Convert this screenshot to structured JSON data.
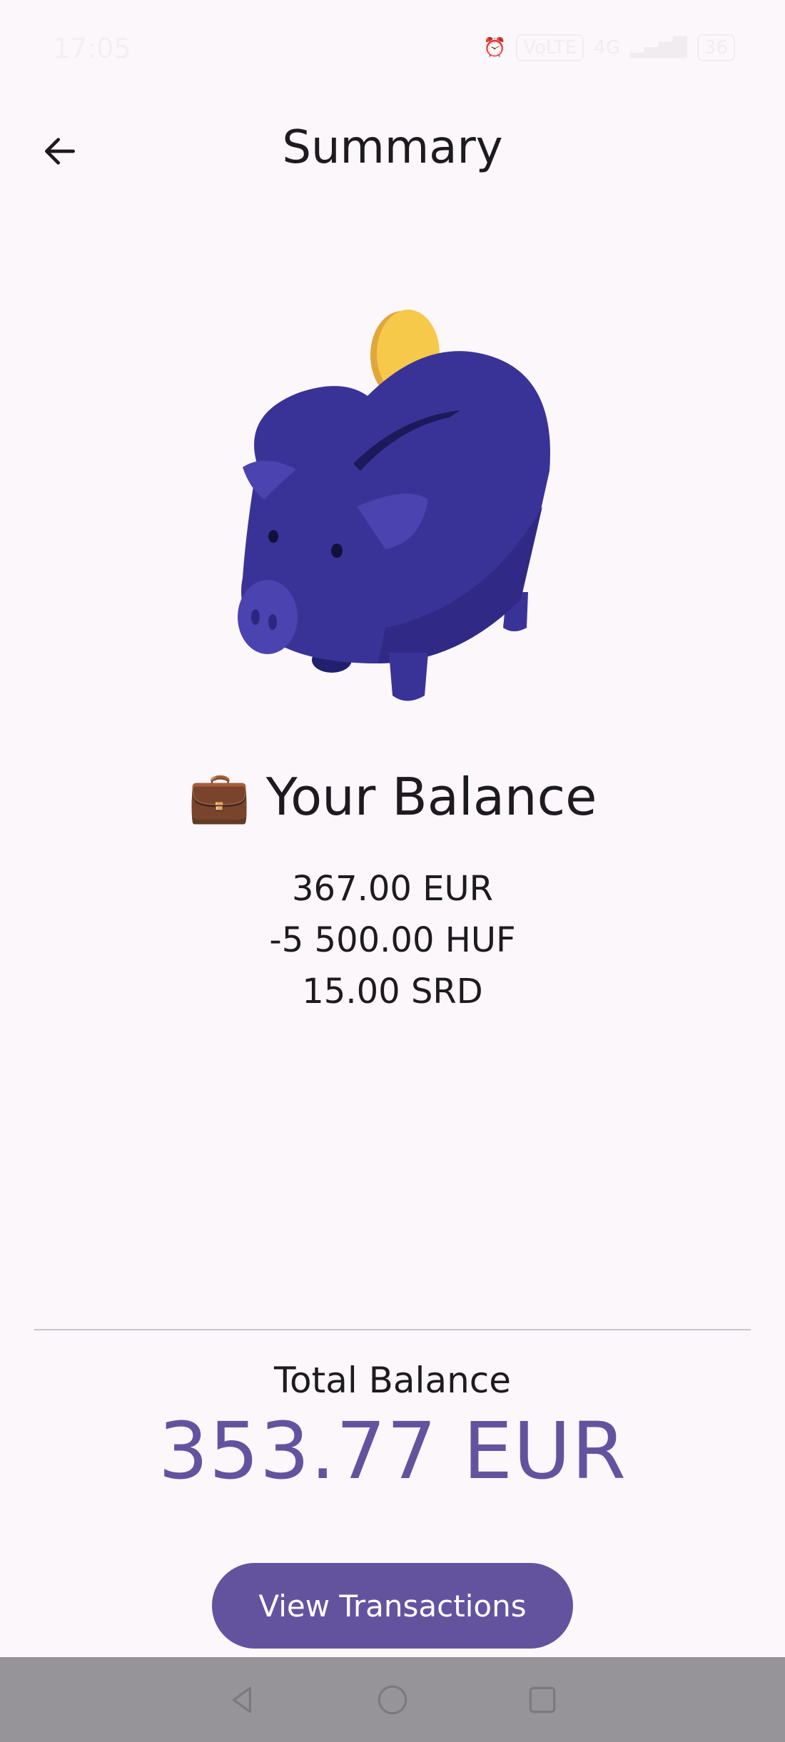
{
  "status_bar": {
    "time": "17:05",
    "network": "4G",
    "data_badge": "VoLTE",
    "battery": "36"
  },
  "app_bar": {
    "title": "Summary",
    "back_icon": "arrow-left-icon"
  },
  "illustration": {
    "name": "piggy-bank-with-coin"
  },
  "balance": {
    "emoji": "💼",
    "heading": "Your Balance",
    "items": [
      "367.00 EUR",
      "-5 500.00 HUF",
      "15.00 SRD"
    ]
  },
  "total": {
    "label": "Total Balance",
    "value": "353.77 EUR"
  },
  "actions": {
    "view_transactions": "View Transactions"
  },
  "navigation": [
    "back-triangle-icon",
    "home-circle-icon",
    "recents-square-icon"
  ],
  "colors": {
    "background": "#fcf7fb",
    "accent": "#63539f",
    "piggy": "#3b3496",
    "coin": "#f6c94b",
    "nav_bar": "#969498"
  }
}
